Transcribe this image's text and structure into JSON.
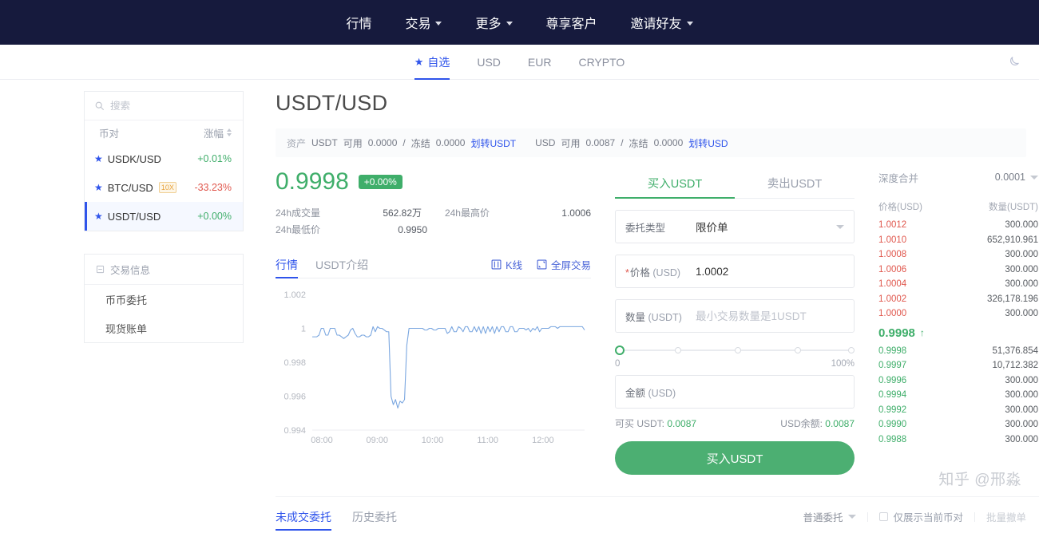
{
  "topnav": {
    "items": [
      {
        "label": "行情",
        "caret": false
      },
      {
        "label": "交易",
        "caret": true
      },
      {
        "label": "更多",
        "caret": true
      },
      {
        "label": "尊享客户",
        "caret": false
      },
      {
        "label": "邀请好友",
        "caret": true
      }
    ]
  },
  "tabbar": {
    "items": [
      {
        "label": "自选",
        "star": "★",
        "active": true
      },
      {
        "label": "USD",
        "active": false
      },
      {
        "label": "EUR",
        "active": false
      },
      {
        "label": "CRYPTO",
        "active": false
      }
    ],
    "theme_toggle_icon": "moon-icon"
  },
  "sidebar": {
    "search_placeholder": "搜索",
    "search_value": "",
    "search_icon": "search-icon",
    "columns": {
      "pair": "币对",
      "change": "涨幅"
    },
    "pairs": [
      {
        "name": "USDK/USD",
        "change": "+0.01%",
        "dir": "up",
        "badge": "",
        "selected": false
      },
      {
        "name": "BTC/USD",
        "change": "-33.23%",
        "dir": "down",
        "badge": "10X",
        "selected": false
      },
      {
        "name": "USDT/USD",
        "change": "+0.00%",
        "dir": "up",
        "badge": "",
        "selected": true
      }
    ],
    "info": {
      "title": "交易信息",
      "icon": "list-icon",
      "items": [
        "币币委托",
        "现货账单"
      ]
    }
  },
  "main": {
    "title": "USDT/USD",
    "assets": {
      "label": "资产",
      "base": {
        "symbol": "USDT",
        "avail_label": "可用",
        "avail": "0.0000",
        "frozen_label": "冻结",
        "frozen": "0.0000",
        "transfer": "划转USDT"
      },
      "quote": {
        "symbol": "USD",
        "avail_label": "可用",
        "avail": "0.0087",
        "frozen_label": "冻结",
        "frozen": "0.0000",
        "transfer": "划转USD"
      }
    },
    "ticker": {
      "price": "0.9998",
      "change_pct": "+0.00%",
      "stats": [
        {
          "label": "24h成交量",
          "value": "562.82万"
        },
        {
          "label": "24h最高价",
          "value": "1.0006"
        },
        {
          "label": "24h最低价",
          "value": "0.9950"
        }
      ]
    },
    "chart_tabs": {
      "items": [
        {
          "label": "行情",
          "active": true
        },
        {
          "label": "USDT介绍",
          "active": false
        }
      ],
      "kline": "K线",
      "kline_icon": "candlestick-icon",
      "fullscreen": "全屏交易",
      "fullscreen_icon": "expand-icon"
    }
  },
  "chart_data": {
    "type": "line",
    "title": "",
    "xlabel": "",
    "ylabel": "",
    "ylim": [
      0.994,
      1.002
    ],
    "yticks": [
      "0.994",
      "0.996",
      "0.998",
      "1",
      "1.002"
    ],
    "xticks": [
      "08:00",
      "09:00",
      "10:00",
      "11:00",
      "12:00"
    ],
    "grid": false,
    "legend": "none",
    "line_color": "#7ba7e0",
    "series": [
      {
        "name": "USDT/USD",
        "x": [
          0,
          1,
          2,
          3,
          4,
          5,
          6,
          7,
          8,
          9,
          10,
          11,
          12,
          13,
          14,
          15,
          16,
          17,
          18,
          19,
          20,
          21,
          22,
          23,
          24,
          25,
          26,
          27,
          28,
          29,
          30,
          31,
          32,
          33,
          34,
          35,
          36,
          37,
          38,
          39,
          40,
          41,
          42,
          43,
          44,
          45,
          46,
          47,
          48,
          49,
          50,
          51,
          52,
          53,
          54,
          55,
          56,
          57,
          58,
          59,
          60,
          61,
          62,
          63,
          64,
          65,
          66,
          67,
          68,
          69,
          70,
          71,
          72,
          73,
          74,
          75,
          76,
          77,
          78,
          79,
          80,
          81,
          82,
          83,
          84,
          85,
          86,
          87,
          88,
          89,
          90,
          91,
          92,
          93,
          94,
          95,
          96,
          97,
          98,
          99,
          100,
          101,
          102,
          103,
          104,
          105,
          106,
          107,
          108,
          109,
          110,
          111,
          112,
          113,
          114,
          115,
          116,
          117,
          118,
          119
        ],
        "values": [
          0.9995,
          0.9995,
          0.9995,
          0.9996,
          1.0,
          1.0,
          0.9996,
          0.9996,
          1.0,
          1.0,
          1.0,
          0.9996,
          0.9996,
          0.9995,
          0.9994,
          0.9995,
          0.9996,
          0.9999,
          1.0,
          0.9997,
          0.9995,
          0.9995,
          0.9996,
          0.9996,
          0.9995,
          0.9995,
          0.9996,
          1.0001,
          0.9998,
          1.0001,
          1.0,
          1.0,
          0.9999,
          0.9998,
          0.9998,
          0.996,
          0.9955,
          0.9958,
          0.9953,
          0.9957,
          0.9956,
          0.9958,
          0.999,
          1.0,
          1.0,
          1.0,
          1.0,
          1.0,
          1.0,
          1.0,
          0.9999,
          0.9999,
          1.0,
          1.0,
          0.9999,
          0.9999,
          1.0,
          1.0,
          1.0,
          1.0,
          0.9997,
          0.9998,
          1.0001,
          0.9998,
          0.9998,
          1.0001,
          1.0,
          0.9998,
          1.0001,
          1.0001,
          0.9998,
          0.9998,
          1.0001,
          0.9998,
          1.0001,
          0.9997,
          1.0001,
          0.9997,
          1.0001,
          0.9998,
          1.0001,
          0.9997,
          1.0001,
          0.9998,
          1.0001,
          1.0001,
          0.9998,
          0.9998,
          1.0001,
          1.0001,
          0.9998,
          0.9998,
          1.0,
          1.0,
          1.0,
          0.9999,
          1.0,
          0.9998,
          1.0,
          0.9999,
          1.0001,
          0.9998,
          1.0,
          1.0,
          1.0,
          1.0,
          1.0001,
          1.0001,
          1.0001,
          1.0,
          1.0001,
          1.0001,
          1.0001,
          1.0001,
          1.0001,
          1.0001,
          1.0001,
          1.0001,
          1.0001,
          1.0001,
          1.0001,
          0.9999
        ]
      }
    ]
  },
  "order_form": {
    "tabs": [
      {
        "label": "买入USDT",
        "active": true
      },
      {
        "label": "卖出USDT",
        "active": false
      }
    ],
    "order_type": {
      "label": "委托类型",
      "value": "限价单"
    },
    "price": {
      "label": "价格",
      "unit": "(USD)",
      "value": "1.0002",
      "required": true
    },
    "amount": {
      "label": "数量",
      "unit": "(USDT)",
      "value": "",
      "placeholder": "最小交易数量是1USDT"
    },
    "slider": {
      "min": "0",
      "max": "100%",
      "value": 0
    },
    "total": {
      "label": "金额",
      "unit": "(USD)",
      "value": "",
      "placeholder": ""
    },
    "buyable": {
      "label": "可买 USDT:",
      "value": "0.0087"
    },
    "balance": {
      "label": "USD余额:",
      "value": "0.0087"
    },
    "submit": "买入USDT"
  },
  "orderbook": {
    "depth_label": "深度合并",
    "depth_value": "0.0001",
    "col_price": "价格(USD)",
    "col_amount": "数量(USDT)",
    "asks": [
      {
        "price": "1.0012",
        "amount": "300.000"
      },
      {
        "price": "1.0010",
        "amount": "652,910.961"
      },
      {
        "price": "1.0008",
        "amount": "300.000"
      },
      {
        "price": "1.0006",
        "amount": "300.000"
      },
      {
        "price": "1.0004",
        "amount": "300.000"
      },
      {
        "price": "1.0002",
        "amount": "326,178.196"
      },
      {
        "price": "1.0000",
        "amount": "300.000"
      }
    ],
    "last_price": "0.9998",
    "last_dir": "↑",
    "bids": [
      {
        "price": "0.9998",
        "amount": "51,376.854"
      },
      {
        "price": "0.9997",
        "amount": "10,712.382"
      },
      {
        "price": "0.9996",
        "amount": "300.000"
      },
      {
        "price": "0.9994",
        "amount": "300.000"
      },
      {
        "price": "0.9992",
        "amount": "300.000"
      },
      {
        "price": "0.9990",
        "amount": "300.000"
      },
      {
        "price": "0.9988",
        "amount": "300.000"
      }
    ]
  },
  "bottom": {
    "tabs": [
      {
        "label": "未成交委托",
        "active": true
      },
      {
        "label": "历史委托",
        "active": false
      }
    ],
    "filter_value": "普通委托",
    "checkbox_label": "仅展示当前币对",
    "batch_cancel": "批量撤单"
  },
  "watermark": "知乎 @邢淼"
}
